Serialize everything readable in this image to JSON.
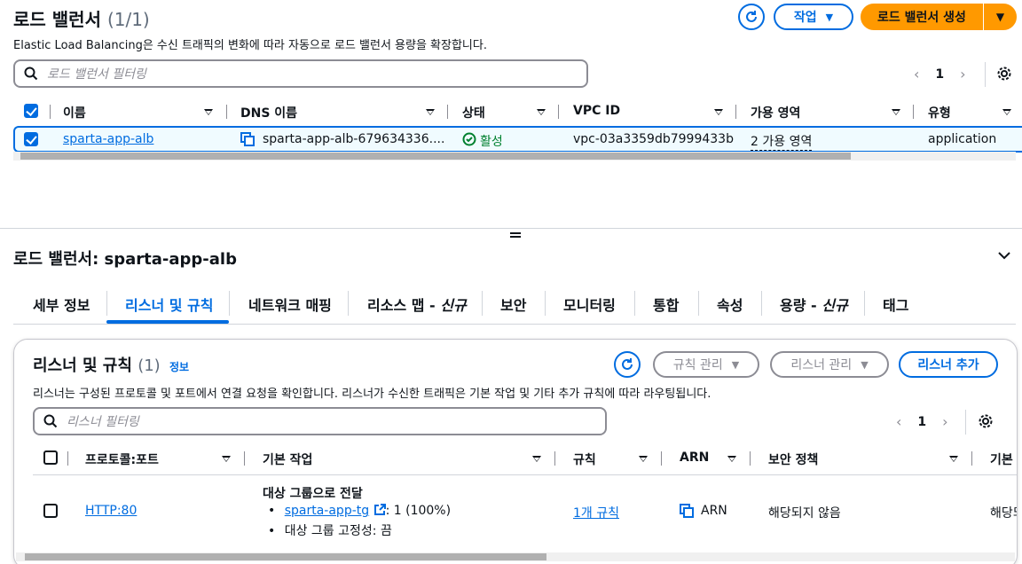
{
  "top": {
    "title": "로드 밸런서",
    "count": "(1/1)",
    "description": "Elastic Load Balancing은 수신 트래픽의 변화에 따라 자동으로 로드 밸런서 용량을 확장합니다.",
    "actions_label": "작업",
    "create_label": "로드 밸런서 생성",
    "search_placeholder": "로드 밸런서 필터링",
    "page": "1",
    "columns": [
      "이름",
      "DNS 이름",
      "상태",
      "VPC ID",
      "가용 영역",
      "유형"
    ],
    "row": {
      "name": "sparta-app-alb",
      "dns": "sparta-app-alb-679634336....",
      "status": "활성",
      "vpc": "vpc-03a3359db7999433b",
      "az": "2 가용 영역",
      "type": "application"
    }
  },
  "detail": {
    "title": "로드 밸런서: sparta-app-alb",
    "tabs": [
      "세부 정보",
      "리스너 및 규칙",
      "네트워크 매핑",
      "리소스 맵 - ",
      "보안",
      "모니터링",
      "통합",
      "속성",
      "용량 - ",
      "태그"
    ],
    "tab_new_suffix": "신규",
    "active_tab": "리스너 및 규칙"
  },
  "listeners": {
    "title": "리스너 및 규칙",
    "count": "(1)",
    "info": "정보",
    "description": "리스너는 구성된 프로토콜 및 포트에서 연결 요청을 확인합니다. 리스너가 수신한 트래픽은 기본 작업 및 기타 추가 규칙에 따라 라우팅됩니다.",
    "manage_rules": "규칙 관리",
    "manage_listener": "리스너 관리",
    "add_listener": "리스너 추가",
    "search_placeholder": "리스너 필터링",
    "page": "1",
    "columns": [
      "프로토콜:포트",
      "기본 작업",
      "규칙",
      "ARN",
      "보안 정책",
      "기본"
    ],
    "row": {
      "protocol": "HTTP:80",
      "action_title": "대상 그룹으로 전달",
      "tg_name": "sparta-app-tg",
      "tg_weight": ": 1 (100%)",
      "stickiness": "대상 그룹 고정성: 끔",
      "rules": "1개 규칙",
      "arn": "ARN",
      "security_policy": "해당되지 않음",
      "default_cut": "해당되"
    }
  },
  "colors": {
    "accent": "#006ce0",
    "primary": "#ff9900",
    "success": "#00802f"
  }
}
